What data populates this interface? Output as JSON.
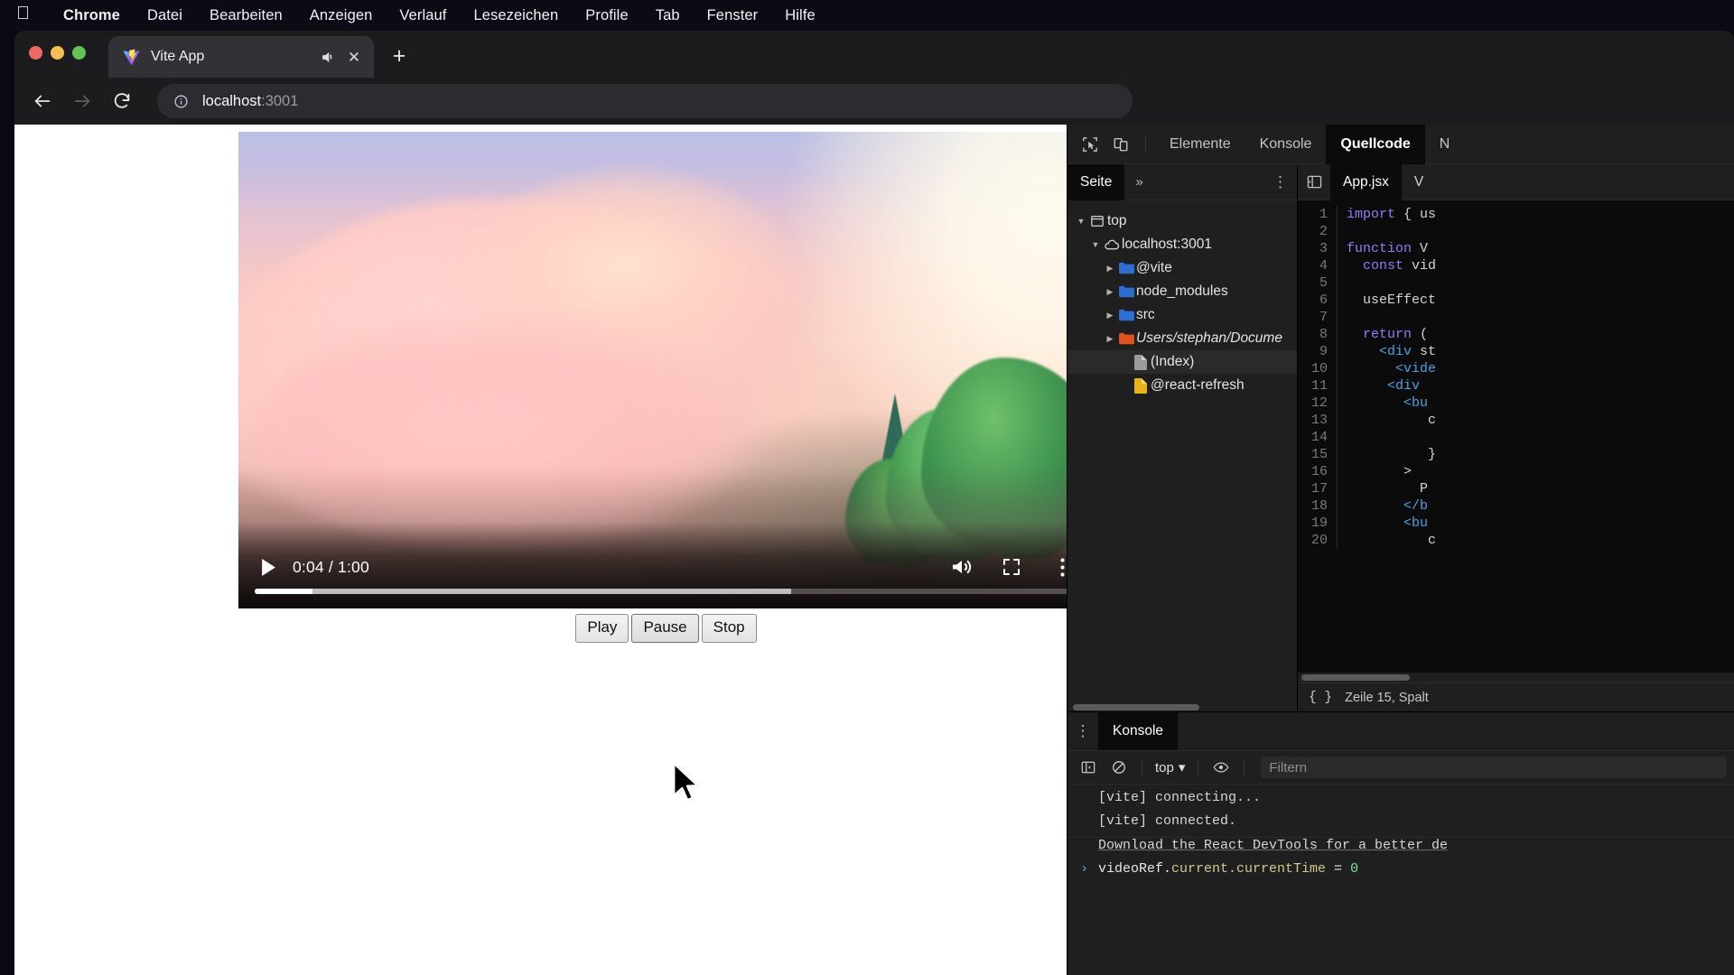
{
  "menubar": {
    "apple_icon": "apple-logo",
    "items": [
      {
        "label": "Chrome",
        "bold": true
      },
      {
        "label": "Datei",
        "bold": false
      },
      {
        "label": "Bearbeiten",
        "bold": false
      },
      {
        "label": "Anzeigen",
        "bold": false
      },
      {
        "label": "Verlauf",
        "bold": false
      },
      {
        "label": "Lesezeichen",
        "bold": false
      },
      {
        "label": "Profile",
        "bold": false
      },
      {
        "label": "Tab",
        "bold": false
      },
      {
        "label": "Fenster",
        "bold": false
      },
      {
        "label": "Hilfe",
        "bold": false
      }
    ]
  },
  "browser": {
    "tab": {
      "title": "Vite App",
      "favicon": "vite-logo-icon",
      "audio_icon": "speaker-icon",
      "close_icon": "close-icon"
    },
    "newtab_label": "+",
    "nav": {
      "back_icon": "arrow-left-icon",
      "forward_icon": "arrow-right-icon",
      "reload_icon": "reload-icon"
    },
    "omnibox": {
      "info_icon": "info-circle-icon",
      "host": "localhost",
      "port": ":3001"
    }
  },
  "video": {
    "play_icon": "play-icon",
    "time": "0:04 / 1:00",
    "volume_icon": "volume-icon",
    "fullscreen_icon": "fullscreen-icon",
    "menu_icon": "kebab-menu-icon",
    "played_percent": 7,
    "buffered_percent": 65
  },
  "controls": {
    "play_label": "Play",
    "pause_label": "Pause",
    "stop_label": "Stop"
  },
  "devtools": {
    "toolbar": {
      "inspect_icon": "inspect-cursor-icon",
      "device_icon": "device-toolbar-icon"
    },
    "tabs": [
      {
        "label": "Elemente",
        "active": false
      },
      {
        "label": "Konsole",
        "active": false
      },
      {
        "label": "Quellcode",
        "active": true
      },
      {
        "label": "N",
        "active": false
      }
    ],
    "navigator": {
      "tabs": [
        {
          "label": "Seite",
          "active": true
        }
      ],
      "more_label": "»",
      "kebab_icon": "kebab-menu-icon",
      "tree": [
        {
          "label": "top",
          "icon": "frame-icon",
          "indent": 0,
          "twisty": "open",
          "selected": false,
          "italic": false
        },
        {
          "label": "localhost:3001",
          "icon": "cloud-icon",
          "indent": 1,
          "twisty": "open",
          "selected": false,
          "italic": false
        },
        {
          "label": "@vite",
          "icon": "folder-blue-icon",
          "indent": 2,
          "twisty": "closed",
          "selected": false,
          "italic": false
        },
        {
          "label": "node_modules",
          "icon": "folder-blue-icon",
          "indent": 2,
          "twisty": "closed",
          "selected": false,
          "italic": false
        },
        {
          "label": "src",
          "icon": "folder-blue-icon",
          "indent": 2,
          "twisty": "closed",
          "selected": false,
          "italic": false
        },
        {
          "label": "Users/stephan/Docume",
          "icon": "folder-orange-icon",
          "indent": 2,
          "twisty": "closed",
          "selected": false,
          "italic": true
        },
        {
          "label": "(Index)",
          "icon": "file-gray-icon",
          "indent": 3,
          "twisty": "none",
          "selected": true,
          "italic": false
        },
        {
          "label": "@react-refresh",
          "icon": "file-yellow-icon",
          "indent": 3,
          "twisty": "none",
          "selected": false,
          "italic": false
        }
      ]
    },
    "editor": {
      "collapse_icon": "panel-collapse-icon",
      "tabs": [
        {
          "label": "App.jsx",
          "active": true
        },
        {
          "label": "V",
          "active": false
        }
      ],
      "lines": [
        {
          "no": 1,
          "tokens": [
            {
              "t": "import",
              "c": "k"
            },
            {
              "t": " { us",
              "c": "pl"
            }
          ]
        },
        {
          "no": 2,
          "tokens": []
        },
        {
          "no": 3,
          "tokens": [
            {
              "t": "function",
              "c": "k"
            },
            {
              "t": " V",
              "c": "pl"
            }
          ]
        },
        {
          "no": 4,
          "tokens": [
            {
              "t": "  ",
              "c": "pl"
            },
            {
              "t": "const",
              "c": "k"
            },
            {
              "t": " vid",
              "c": "pl"
            }
          ]
        },
        {
          "no": 5,
          "tokens": []
        },
        {
          "no": 6,
          "tokens": [
            {
              "t": "  useEffect",
              "c": "pl"
            }
          ]
        },
        {
          "no": 7,
          "tokens": []
        },
        {
          "no": 8,
          "tokens": [
            {
              "t": "  ",
              "c": "pl"
            },
            {
              "t": "return",
              "c": "k"
            },
            {
              "t": " (",
              "c": "pl"
            }
          ]
        },
        {
          "no": 9,
          "tokens": [
            {
              "t": "    ",
              "c": "pl"
            },
            {
              "t": "<div",
              "c": "tg"
            },
            {
              "t": " st",
              "c": "pl"
            }
          ]
        },
        {
          "no": 10,
          "tokens": [
            {
              "t": "      ",
              "c": "pl"
            },
            {
              "t": "<vide",
              "c": "tg"
            }
          ]
        },
        {
          "no": 11,
          "tokens": [
            {
              "t": "     ",
              "c": "pl"
            },
            {
              "t": "<div",
              "c": "tg"
            },
            {
              "t": " ",
              "c": "pl"
            }
          ]
        },
        {
          "no": 12,
          "tokens": [
            {
              "t": "       ",
              "c": "pl"
            },
            {
              "t": "<bu",
              "c": "tg"
            }
          ]
        },
        {
          "no": 13,
          "tokens": [
            {
              "t": "          c",
              "c": "pl"
            }
          ]
        },
        {
          "no": 14,
          "tokens": []
        },
        {
          "no": 15,
          "tokens": [
            {
              "t": "          }",
              "c": "pl"
            }
          ]
        },
        {
          "no": 16,
          "tokens": [
            {
              "t": "       >",
              "c": "pl"
            }
          ]
        },
        {
          "no": 17,
          "tokens": [
            {
              "t": "         P",
              "c": "pl"
            }
          ]
        },
        {
          "no": 18,
          "tokens": [
            {
              "t": "       ",
              "c": "pl"
            },
            {
              "t": "</b",
              "c": "tg"
            }
          ]
        },
        {
          "no": 19,
          "tokens": [
            {
              "t": "       ",
              "c": "pl"
            },
            {
              "t": "<bu",
              "c": "tg"
            }
          ]
        },
        {
          "no": 20,
          "tokens": [
            {
              "t": "          c",
              "c": "pl"
            }
          ]
        }
      ],
      "status": {
        "format_icon": "{ }",
        "position": "Zeile 15, Spalt"
      }
    },
    "drawer": {
      "kebab_icon": "kebab-menu-icon",
      "tab_label": "Konsole",
      "toolbar": {
        "sidebar_icon": "console-sidebar-icon",
        "clear_icon": "clear-console-icon",
        "context": "top",
        "context_caret": "▾",
        "eye_icon": "live-expression-icon",
        "filter_placeholder": "Filtern"
      },
      "logs": [
        {
          "type": "log",
          "prompt": "",
          "text": "[vite] connecting...",
          "sep": false
        },
        {
          "type": "log",
          "prompt": "",
          "text": "[vite] connected.",
          "sep": true
        },
        {
          "type": "info",
          "prompt": "",
          "text": "Download the React DevTools for a better de",
          "sep": false
        },
        {
          "type": "input",
          "prompt": "›",
          "base": "videoRef.",
          "prop": "current.currentTime",
          "eq": " = ",
          "value": "0",
          "sep": false
        }
      ]
    }
  }
}
